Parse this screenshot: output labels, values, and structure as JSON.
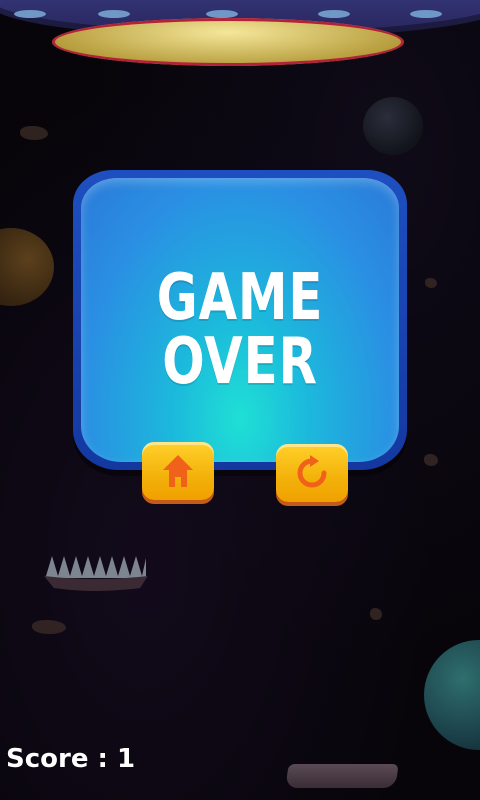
{
  "title": {
    "line1": "GAME",
    "line2": "OVER"
  },
  "buttons": {
    "home": {
      "icon": "home-icon"
    },
    "restart": {
      "icon": "restart-icon"
    }
  },
  "score": {
    "text": "Score : 1"
  },
  "colors": {
    "panel": "#2a8fe3",
    "panel_glow": "#1fe0d5",
    "panel_border": "#1e4fc0",
    "button": "#ffd12a",
    "icon": "#f0621a",
    "background": "#07050a"
  }
}
